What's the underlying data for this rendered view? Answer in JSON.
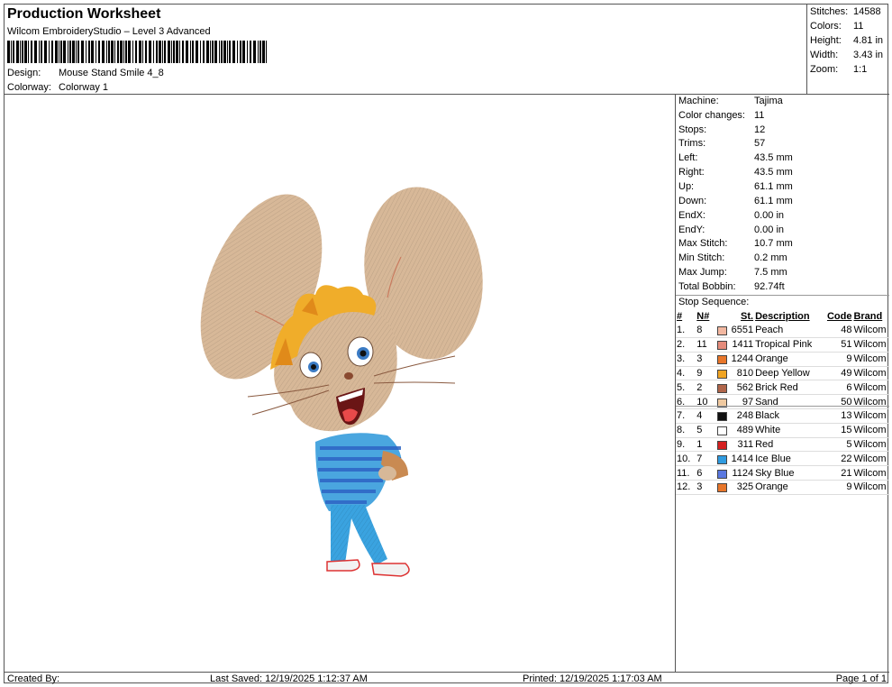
{
  "header": {
    "title": "Production Worksheet",
    "subtitle": "Wilcom EmbroideryStudio – Level 3 Advanced",
    "design_label": "Design:",
    "design_value": "Mouse Stand Smile 4_8",
    "colorway_label": "Colorway:",
    "colorway_value": "Colorway 1"
  },
  "stats": [
    {
      "label": "Stitches:",
      "value": "14588"
    },
    {
      "label": "Colors:",
      "value": "11"
    },
    {
      "label": "Height:",
      "value": "4.81 in"
    },
    {
      "label": "Width:",
      "value": "3.43 in"
    },
    {
      "label": "Zoom:",
      "value": "1:1"
    }
  ],
  "machine_info": [
    {
      "label": "Machine:",
      "value": "Tajima"
    },
    {
      "label": "Color changes:",
      "value": "11"
    },
    {
      "label": "Stops:",
      "value": "12"
    },
    {
      "label": "Trims:",
      "value": "57"
    },
    {
      "label": "Left:",
      "value": "43.5 mm"
    },
    {
      "label": "Right:",
      "value": "43.5 mm"
    },
    {
      "label": "Up:",
      "value": "61.1 mm"
    },
    {
      "label": "Down:",
      "value": "61.1 mm"
    },
    {
      "label": "EndX:",
      "value": "0.00 in"
    },
    {
      "label": "EndY:",
      "value": "0.00 in"
    },
    {
      "label": "Max Stitch:",
      "value": "10.7 mm"
    },
    {
      "label": "Min Stitch:",
      "value": "0.2 mm"
    },
    {
      "label": "Max Jump:",
      "value": "7.5 mm"
    },
    {
      "label": "Total Bobbin:",
      "value": "92.74ft"
    }
  ],
  "stop_sequence": {
    "title": "Stop Sequence:",
    "columns": [
      "#",
      "N#",
      "St.",
      "Description",
      "Code",
      "Brand"
    ],
    "rows": [
      {
        "idx": "1.",
        "n": "8",
        "st": "6551",
        "desc": "Peach",
        "code": "48",
        "brand": "Wilcom",
        "color": "#f2b7a0"
      },
      {
        "idx": "2.",
        "n": "11",
        "st": "1411",
        "desc": "Tropical Pink",
        "code": "51",
        "brand": "Wilcom",
        "color": "#e58b7b"
      },
      {
        "idx": "3.",
        "n": "3",
        "st": "1244",
        "desc": "Orange",
        "code": "9",
        "brand": "Wilcom",
        "color": "#e8762a"
      },
      {
        "idx": "4.",
        "n": "9",
        "st": "810",
        "desc": "Deep Yellow",
        "code": "49",
        "brand": "Wilcom",
        "color": "#f0a422"
      },
      {
        "idx": "5.",
        "n": "2",
        "st": "562",
        "desc": "Brick Red",
        "code": "6",
        "brand": "Wilcom",
        "color": "#b0654a"
      },
      {
        "idx": "6.",
        "n": "10",
        "st": "97",
        "desc": "Sand",
        "code": "50",
        "brand": "Wilcom",
        "color": "#efc9a0"
      },
      {
        "idx": "7.",
        "n": "4",
        "st": "248",
        "desc": "Black",
        "code": "13",
        "brand": "Wilcom",
        "color": "#111111"
      },
      {
        "idx": "8.",
        "n": "5",
        "st": "489",
        "desc": "White",
        "code": "15",
        "brand": "Wilcom",
        "color": "#ffffff"
      },
      {
        "idx": "9.",
        "n": "1",
        "st": "311",
        "desc": "Red",
        "code": "5",
        "brand": "Wilcom",
        "color": "#d42020"
      },
      {
        "idx": "10.",
        "n": "7",
        "st": "1414",
        "desc": "Ice Blue",
        "code": "22",
        "brand": "Wilcom",
        "color": "#2f9be0"
      },
      {
        "idx": "11.",
        "n": "6",
        "st": "1124",
        "desc": "Sky Blue",
        "code": "21",
        "brand": "Wilcom",
        "color": "#5a78e0"
      },
      {
        "idx": "12.",
        "n": "3",
        "st": "325",
        "desc": "Orange",
        "code": "9",
        "brand": "Wilcom",
        "color": "#e8762a"
      }
    ]
  },
  "footer": {
    "created_by": "Created By:",
    "last_saved": "Last Saved: 12/19/2025 1:12:37 AM",
    "printed": "Printed: 12/19/2025 1:17:03 AM",
    "page": "Page 1 of 1"
  }
}
